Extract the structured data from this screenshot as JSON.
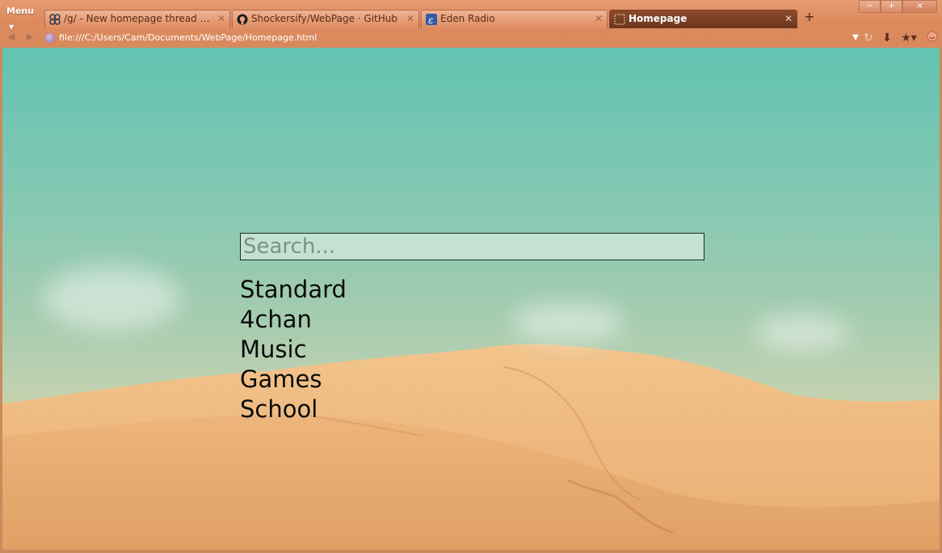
{
  "browser": {
    "menu_label": "Menu",
    "tabs": [
      {
        "title": "/g/ - New homepage thread due t...",
        "favicon": "4chan-clover-icon",
        "active": false
      },
      {
        "title": "Shockersify/WebPage · GitHub",
        "favicon": "github-octocat-icon",
        "active": false
      },
      {
        "title": "Eden Radio",
        "favicon": "eden-radio-icon",
        "active": false
      },
      {
        "title": "Homepage",
        "favicon": "blank-page-icon",
        "active": true
      }
    ],
    "new_tab_symbol": "+",
    "window_controls": {
      "minimize": "−",
      "maximize": "+",
      "close": "×"
    },
    "url": "file:///C:/Users/Cam/Documents/WebPage/Homepage.html",
    "accent": "#dd8a5e"
  },
  "page": {
    "search": {
      "placeholder": "Search...",
      "value": ""
    },
    "links": [
      "Standard",
      "4chan",
      "Music",
      "Games",
      "School"
    ],
    "sky_color": "#62c3b1",
    "sand_color": "#e8b57c"
  }
}
